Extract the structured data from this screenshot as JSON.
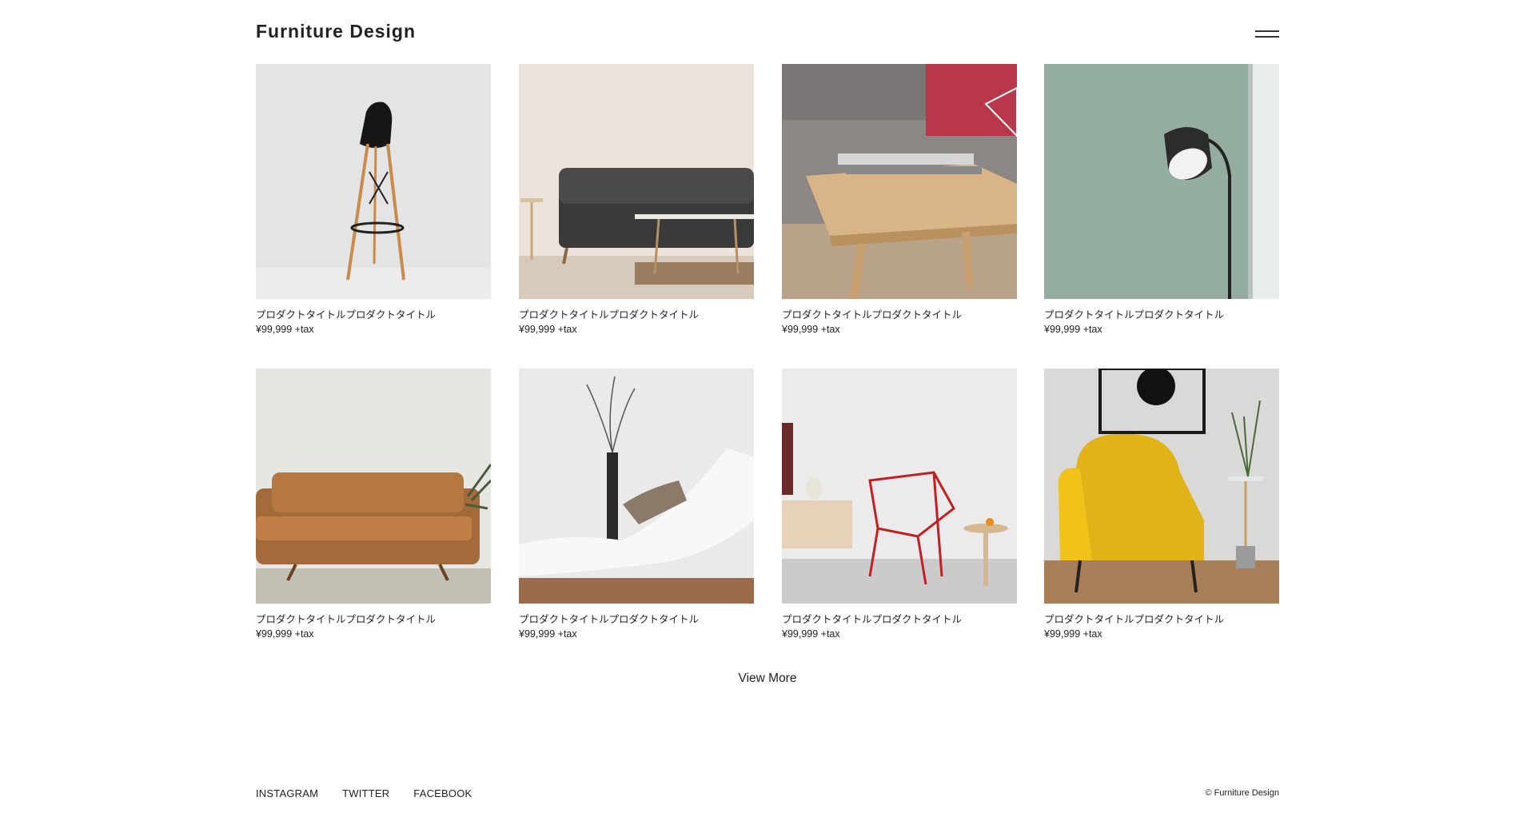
{
  "header": {
    "title": "Furniture Design",
    "menu_icon": "hamburger-menu-icon"
  },
  "products": [
    {
      "title": "プロダクトタイトルプロダクトタイトル",
      "price": "¥99,999 +tax",
      "image": "bar-stool-photo"
    },
    {
      "title": "プロダクトタイトルプロダクトタイトル",
      "price": "¥99,999 +tax",
      "image": "dark-sofa-photo"
    },
    {
      "title": "プロダクトタイトルプロダクトタイトル",
      "price": "¥99,999 +tax",
      "image": "wood-table-photo"
    },
    {
      "title": "プロダクトタイトルプロダクトタイトル",
      "price": "¥99,999 +tax",
      "image": "floor-lamp-photo"
    },
    {
      "title": "プロダクトタイトルプロダクトタイトル",
      "price": "¥99,999 +tax",
      "image": "leather-sofa-photo"
    },
    {
      "title": "プロダクトタイトルプロダクトタイトル",
      "price": "¥99,999 +tax",
      "image": "white-lounger-photo"
    },
    {
      "title": "プロダクトタイトルプロダクトタイトル",
      "price": "¥99,999 +tax",
      "image": "red-wire-chair-photo"
    },
    {
      "title": "プロダクトタイトルプロダクトタイトル",
      "price": "¥99,999 +tax",
      "image": "yellow-armchair-photo"
    }
  ],
  "view_more": "View More",
  "footer": {
    "links": [
      "INSTAGRAM",
      "TWITTER",
      "FACEBOOK"
    ],
    "copyright": "© Furniture Design"
  }
}
